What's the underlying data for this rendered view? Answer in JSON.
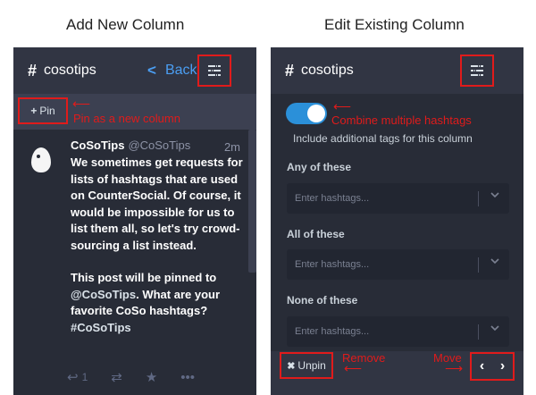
{
  "captions": {
    "left": "Add New Column",
    "right": "Edit Existing Column"
  },
  "left_panel": {
    "header": {
      "hash": "#",
      "title": "cosotips",
      "back_label": "Back",
      "back_icon": "chevron-left-icon",
      "settings_icon": "sliders-icon"
    },
    "pin": {
      "icon": "+",
      "label": "Pin",
      "annotation": "Pin as a new column"
    },
    "post": {
      "name": "CoSoTips",
      "handle": "@CoSoTips",
      "time": "2m",
      "paragraph1": "We sometimes get requests for lists of hashtags that are used on CounterSocial. Of course, it would be impossible for us to list them all, so let's try crowd-sourcing a list instead.",
      "paragraph2_a": "This post will be pinned to ",
      "paragraph2_mention": "@CoSoTips",
      "paragraph2_b": ". What are your favorite CoSo hashtags? ",
      "paragraph2_tag": "#CoSoTips",
      "reply_count": "1"
    }
  },
  "right_panel": {
    "header": {
      "hash": "#",
      "title": "cosotips",
      "settings_icon": "sliders-icon"
    },
    "toggle": {
      "state": true,
      "annotation": "Combine multiple hashtags",
      "description": "Include additional tags for this column"
    },
    "fields": [
      {
        "label": "Any of these",
        "placeholder": "Enter hashtags..."
      },
      {
        "label": "All of these",
        "placeholder": "Enter hashtags..."
      },
      {
        "label": "None of these",
        "placeholder": "Enter hashtags..."
      }
    ],
    "footer": {
      "unpin_icon": "✖",
      "unpin_label": "Unpin",
      "remove_annotation": "Remove",
      "move_annotation": "Move",
      "move_left": "‹",
      "move_right": "›"
    }
  },
  "colors": {
    "panel_bg": "#282c37",
    "header_bg": "#313543",
    "accent": "#2b90d9",
    "link": "#4b9ef2",
    "annotation": "#e01b1b"
  }
}
